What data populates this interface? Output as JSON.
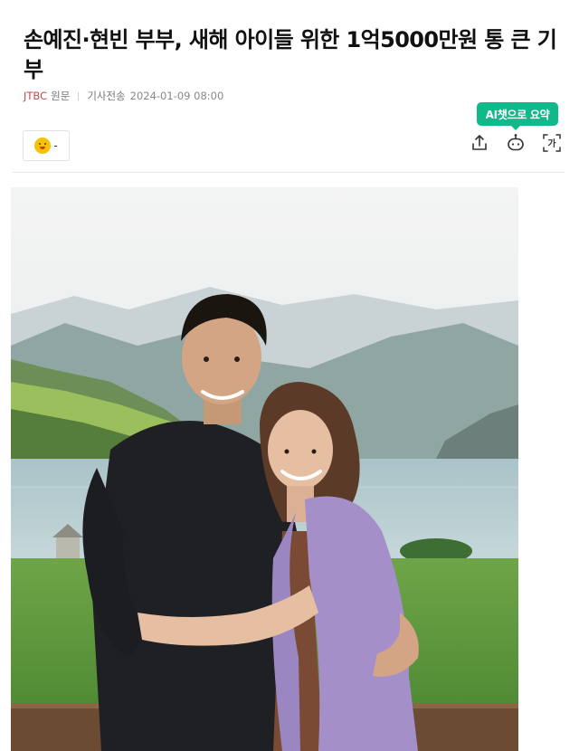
{
  "article": {
    "headline": "손예진·현빈 부부, 새해 아이들 위한 1억5000만원 통 큰 기부",
    "press": "JTBC",
    "press_suffix": "원문",
    "sent_label": "기사전송",
    "timestamp": "2024-01-09 08:00"
  },
  "toolbar": {
    "reaction_count": "-",
    "ai_summary_tooltip": "AI챗으로 요약",
    "font_icon_label": "가",
    "icons": [
      "share-icon",
      "ai-chatbot-icon",
      "font-size-icon"
    ]
  },
  "photo": {
    "subject": "photo-couple-lakeside"
  },
  "colors": {
    "ai_green": "#11b88a",
    "press_red": "#c04a4a",
    "sweater_lavender": "#a48fc9"
  }
}
